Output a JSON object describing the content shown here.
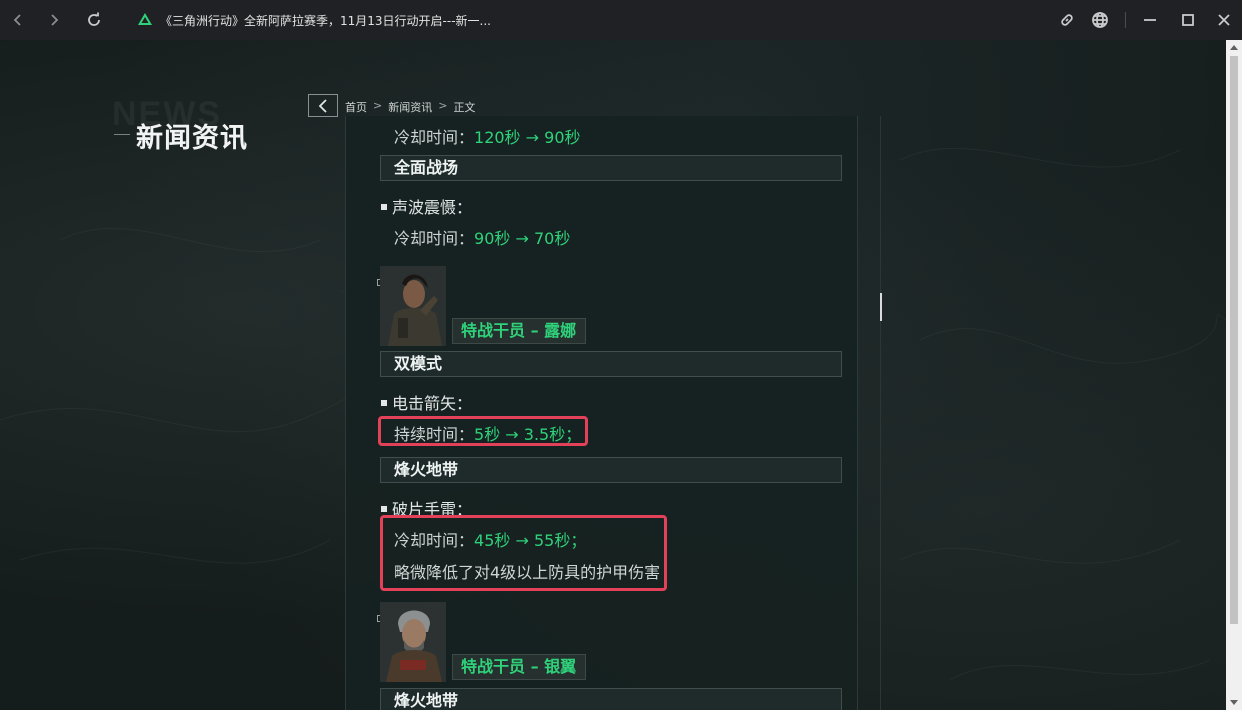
{
  "browser": {
    "tab_title": "《三角洲行动》全新阿萨拉赛季，11月13日行动开启---新一...",
    "icons": [
      "back-icon",
      "forward-icon",
      "reload-icon",
      "favicon",
      "link-icon",
      "globe-icon",
      "minimize-icon",
      "maximize-icon",
      "close-icon"
    ]
  },
  "page": {
    "ghost_word": "NEWS",
    "heading": "新闻资讯",
    "breadcrumb": {
      "home": "首页",
      "news": "新闻资讯",
      "current": "正文",
      "separator": ">"
    }
  },
  "article": {
    "line1": {
      "label": "冷却时间：",
      "value": "120秒 → 90秒"
    },
    "section1": "全面战场",
    "skill1": "声波震慑：",
    "line2": {
      "label": "冷却时间：",
      "value": "90秒 → 70秒"
    },
    "operator1": "特战干员 – 露娜",
    "section2": "双模式",
    "skill2": "电击箭矢：",
    "line3": {
      "label": "持续时间：",
      "value": "5秒 → 3.5秒；"
    },
    "section3": "烽火地带",
    "skill3": "破片手雷：",
    "line4": {
      "label": "冷却时间：",
      "value": "45秒 → 55秒；"
    },
    "line5": "略微降低了对4级以上防具的护甲伤害",
    "operator2": "特战干员 – 银翼",
    "section4": "烽火地带"
  },
  "colors": {
    "accent_green": "#2fd27a",
    "highlight_red": "#e3415a",
    "panel_bg": "#162221"
  }
}
